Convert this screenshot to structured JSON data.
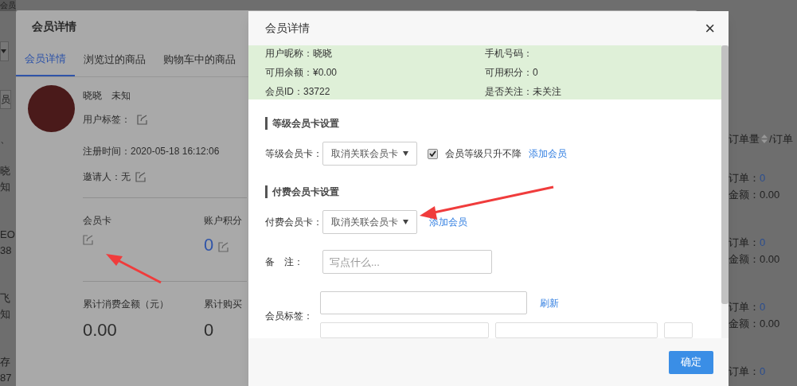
{
  "background_page": {
    "header_fragment": "会员",
    "button_fragment": "员",
    "text_fragment": "、",
    "left_rows": [
      {
        "line_1": "晓",
        "line_2": "知"
      },
      {
        "line_1": "EO",
        "line_2": "38"
      },
      {
        "line_1": "飞",
        "line_2": "知"
      },
      {
        "line_1": "存",
        "line_2": "87"
      }
    ],
    "orders_column": {
      "heading": "订单量",
      "heading_suffix": "/订单"
    },
    "order_rows": [
      {
        "orders_label": "订单：",
        "orders": "0",
        "amount": "金额：0.00"
      },
      {
        "orders_label": "订单：",
        "orders": "0",
        "amount": "金额：0.00"
      },
      {
        "orders_label": "订单：",
        "orders": "0",
        "amount": "金额：0.00"
      },
      {
        "orders_label": "订单：",
        "orders": "0"
      }
    ]
  },
  "member_dialog": {
    "title": "会员详情",
    "tabs": [
      {
        "label": "会员详情",
        "selected": true
      },
      {
        "label": "浏览过的商品",
        "selected": false
      },
      {
        "label": "购物车中的商品",
        "selected": false
      }
    ],
    "name": "晓晓",
    "gender": "未知",
    "tags_label": "用户标签：",
    "registered": "注册时间：2020-05-18 16:12:06",
    "inviter": "邀请人：无",
    "stats": [
      {
        "label": "会员卡"
      },
      {
        "label": "账户积分",
        "value": "0"
      }
    ],
    "totals": [
      {
        "label": "累计消费金额（元）",
        "value": "0.00"
      },
      {
        "label": "累计购买",
        "value": "0"
      }
    ]
  },
  "settings_dialog": {
    "title": "会员详情",
    "close": "×",
    "info": [
      {
        "text": "用户昵称：晓晓"
      },
      {
        "text": "手机号码："
      },
      {
        "text": "可用余额：¥0.00"
      },
      {
        "text": "可用积分：0"
      },
      {
        "text": "会员ID：33722"
      },
      {
        "text": "是否关注：未关注"
      }
    ],
    "level_section": {
      "heading": "等级会员卡设置",
      "label": "等级会员卡：",
      "select": "取消关联会员卡",
      "checkbox": {
        "label": "会员等级只升不降",
        "checked": true
      },
      "link": "添加会员"
    },
    "paid_section": {
      "heading": "付费会员卡设置",
      "label": "付费会员卡：",
      "select": "取消关联会员卡",
      "link": "添加会员"
    },
    "note": {
      "label": "备　注：",
      "placeholder": "写点什么..."
    },
    "tags": {
      "label": "会员标签：",
      "refresh": "刷新"
    },
    "confirm": "确定"
  }
}
